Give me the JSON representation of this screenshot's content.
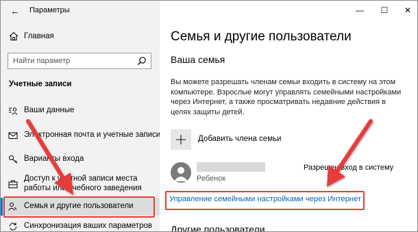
{
  "window": {
    "app_title": "Параметры",
    "minimize_glyph": "—",
    "maximize_glyph": "☐",
    "close_glyph": "✕"
  },
  "sidebar": {
    "home_label": "Главная",
    "search_placeholder": "Найти параметр",
    "section_label": "Учетные записи",
    "items": [
      {
        "label": "Ваши данные",
        "icon": "person-card-icon",
        "selected": false
      },
      {
        "label": "Электронная почта и учетные записи",
        "icon": "mail-icon",
        "selected": false
      },
      {
        "label": "Варианты входа",
        "icon": "key-icon",
        "selected": false
      },
      {
        "label": "Доступ к учетной записи места работы или учебного заведения",
        "icon": "briefcase-icon",
        "selected": false
      },
      {
        "label": "Семья и другие пользователи",
        "icon": "people-icon",
        "selected": true
      },
      {
        "label": "Синхронизация ваших параметров",
        "icon": "sync-icon",
        "selected": false
      }
    ]
  },
  "main": {
    "page_title": "Семья и другие пользователи",
    "section_title": "Ваша семья",
    "description": "Вы можете разрешать членам семьи входить в систему на этом компьютере. Взрослые могут управлять семейными настройками через Интернет, а также просматривать недавние действия в целях защиты детей.",
    "add_member_label": "Добавить члена семьи",
    "member": {
      "role": "Ребенок",
      "status": "Разрешен вход в систему"
    },
    "manage_link": "Управление семейными настройками через Интернет",
    "next_section_title": "Другие пользователи"
  },
  "colors": {
    "accent": "#0078d7",
    "link": "#0066b4",
    "annotation": "#e83a3a",
    "sidebar_bg": "#f2f2f2"
  }
}
